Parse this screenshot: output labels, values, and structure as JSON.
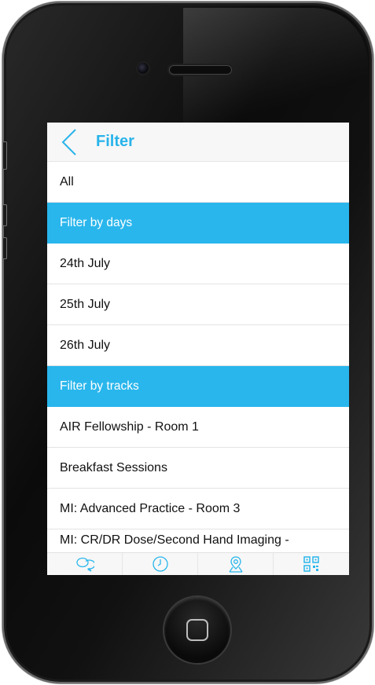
{
  "header": {
    "title": "Filter",
    "back_icon": "chevron-left-icon"
  },
  "list": {
    "all_label": "All",
    "days_section": "Filter by days",
    "days": [
      "24th July",
      "25th July",
      "26th July"
    ],
    "tracks_section": "Filter by tracks",
    "tracks": [
      "AIR Fellowship - Room 1",
      "Breakfast Sessions",
      "MI: Advanced Practice - Room 3",
      "MI: CR/DR Dose/Second Hand Imaging -"
    ]
  },
  "tabbar": {
    "icons": [
      "chat-bubbles-icon",
      "clock-icon",
      "map-pin-icon",
      "qr-code-icon"
    ]
  },
  "colors": {
    "accent": "#29b6ec",
    "title": "#29b4ea",
    "header_bg": "#f7f7f7"
  }
}
